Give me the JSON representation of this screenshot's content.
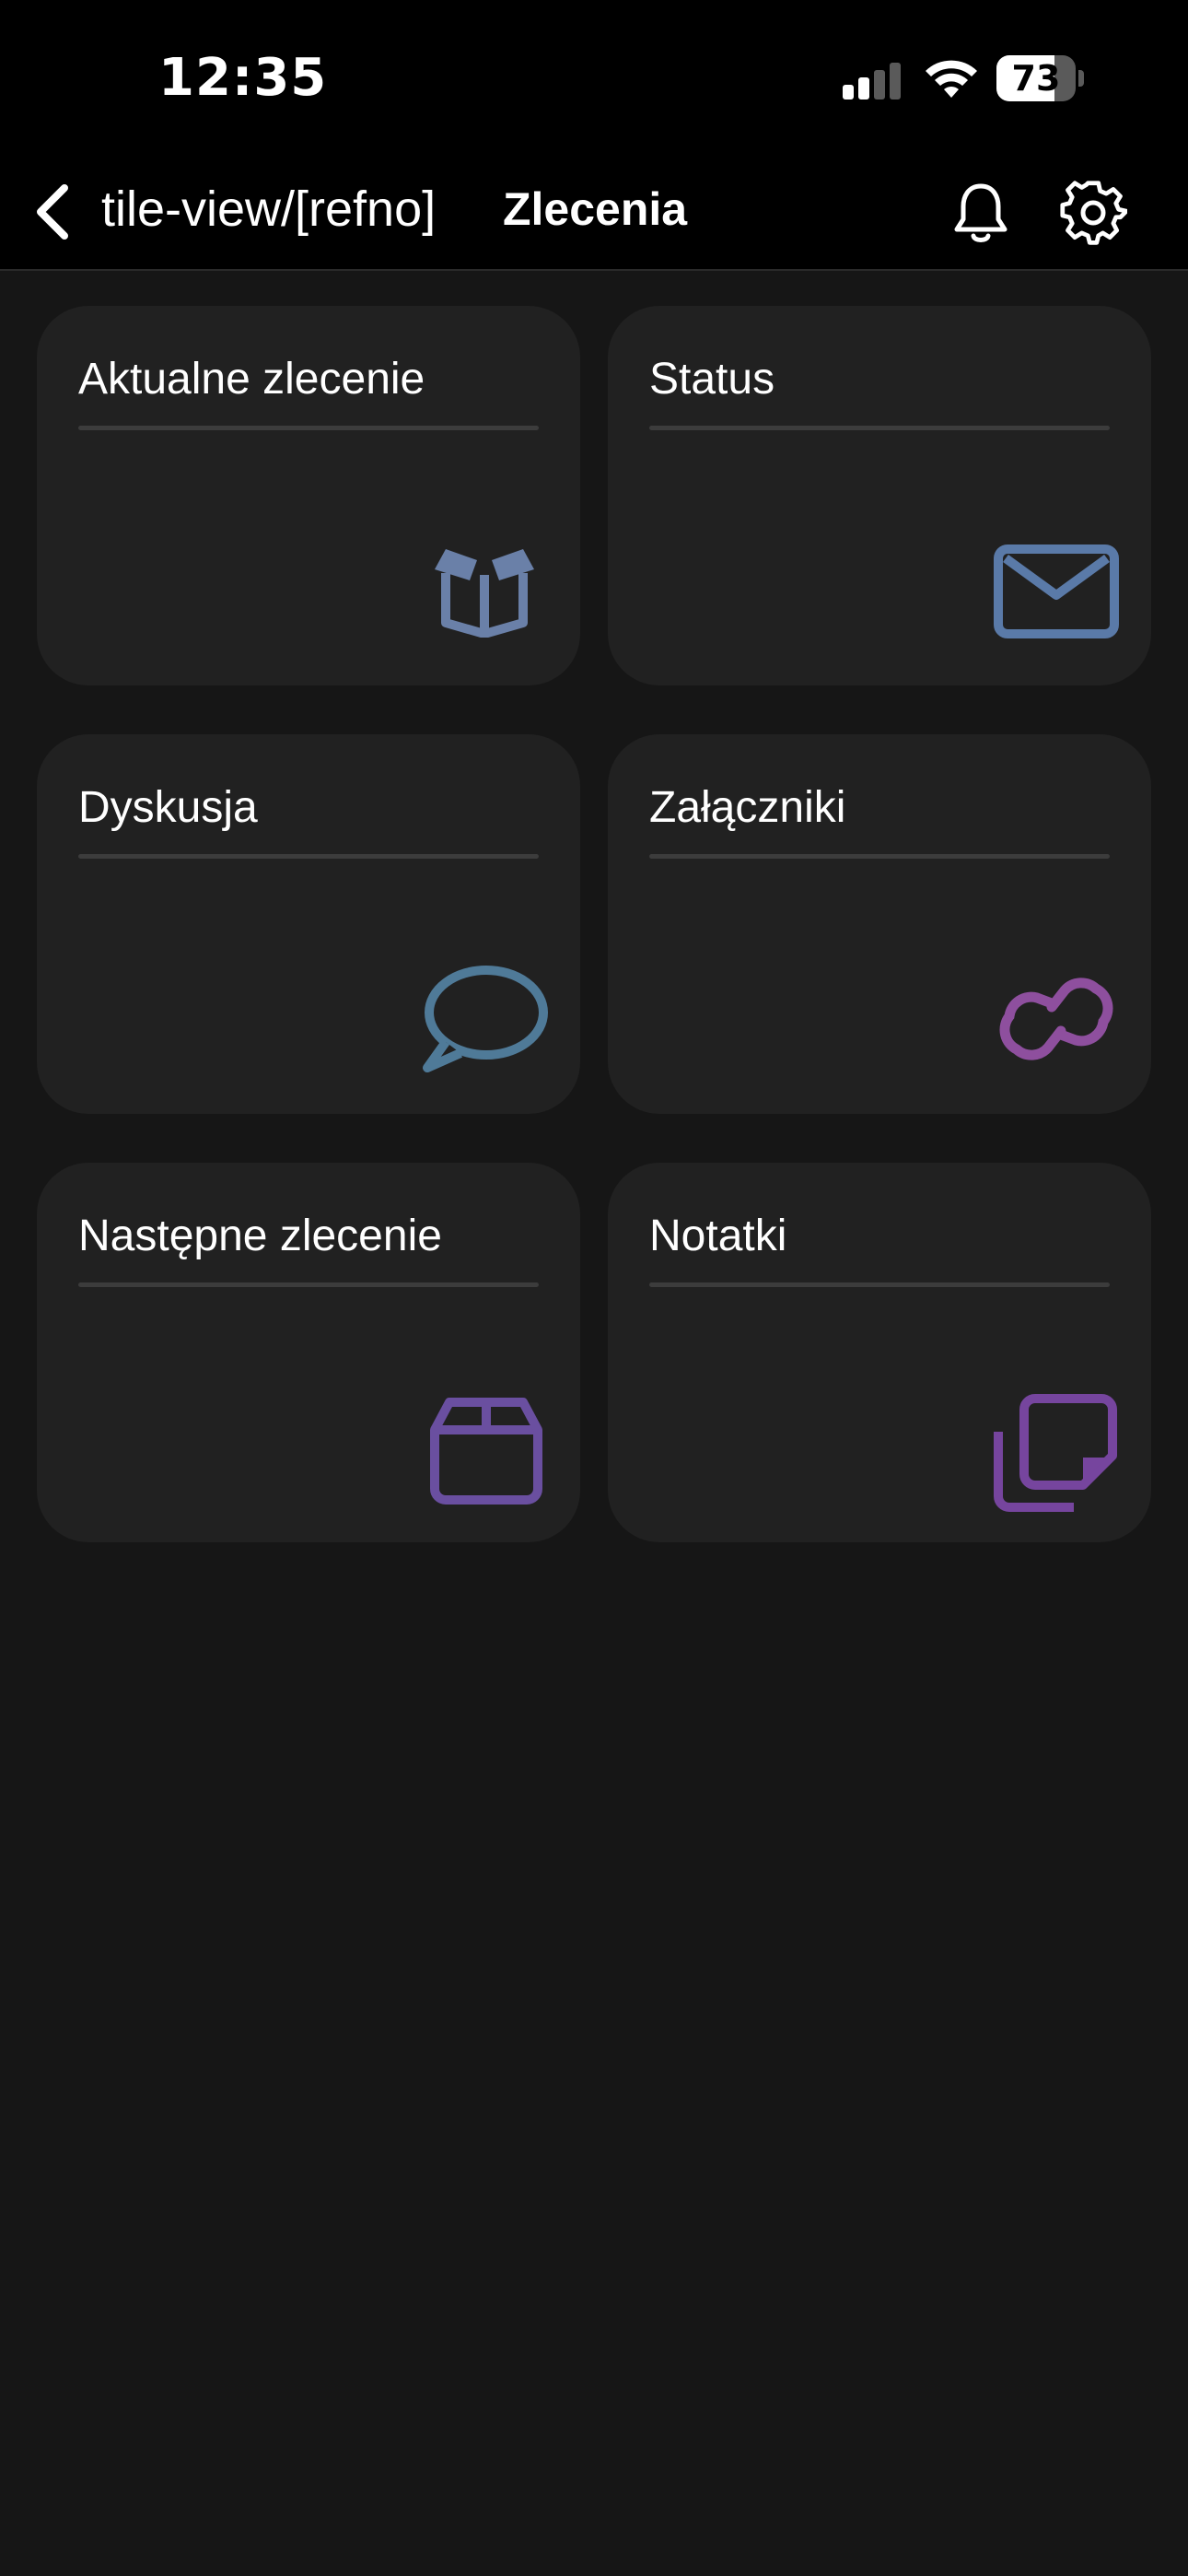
{
  "status_bar": {
    "time": "12:35",
    "battery_percent": 73
  },
  "header": {
    "back_icon": "chevron-left-icon",
    "route": "tile-view/[refno]",
    "title": "Zlecenia",
    "bell_icon": "bell-icon",
    "settings_icon": "gear-icon"
  },
  "tiles": [
    {
      "label": "Aktualne zlecenie",
      "icon": "open-box-icon",
      "icon_color": "#6a80a8"
    },
    {
      "label": "Status",
      "icon": "envelope-icon",
      "icon_color": "#5a7aa8"
    },
    {
      "label": "Dyskusja",
      "icon": "chat-bubble-icon",
      "icon_color": "#4f7a98"
    },
    {
      "label": "Załączniki",
      "icon": "link-icon",
      "icon_color": "#8e4f9e"
    },
    {
      "label": "Następne zlecenie",
      "icon": "package-icon",
      "icon_color": "#6a4fa0"
    },
    {
      "label": "Notatki",
      "icon": "notes-stack-icon",
      "icon_color": "#76459e"
    }
  ]
}
